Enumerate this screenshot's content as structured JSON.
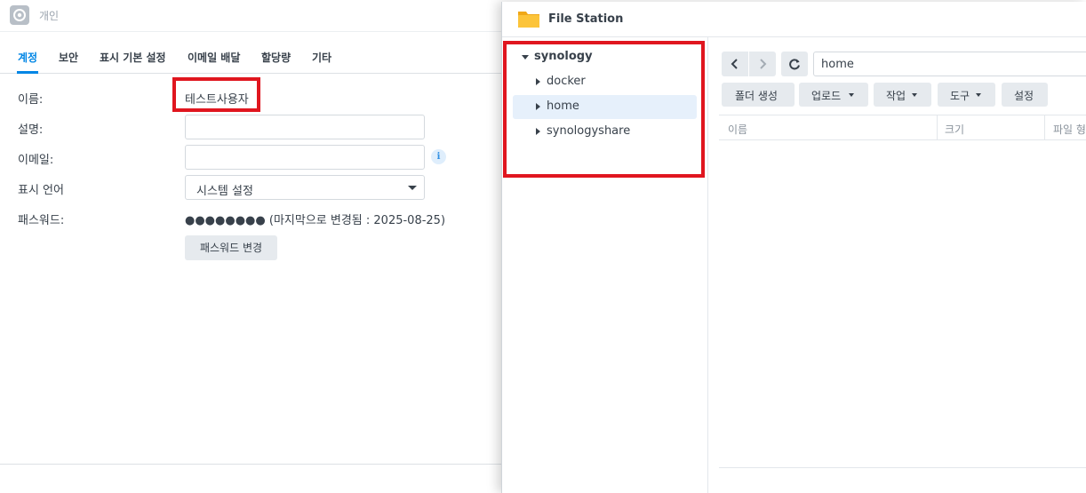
{
  "personal": {
    "title": "개인",
    "tabs": [
      {
        "label": "계정",
        "active": true
      },
      {
        "label": "보안"
      },
      {
        "label": "표시 기본 설정"
      },
      {
        "label": "이메일 배달"
      },
      {
        "label": "할당량"
      },
      {
        "label": "기타"
      }
    ],
    "form": {
      "name_label": "이름:",
      "name_value": "테스트사용자",
      "description_label": "설명:",
      "description_value": "",
      "email_label": "이메일:",
      "email_value": "",
      "info_icon": "i",
      "language_label": "표시 언어",
      "language_value": "시스템 설정",
      "password_label": "패스워드:",
      "password_value": "●●●●●●●● (마지막으로 변경됨 : 2025-08-25)",
      "change_password_button": "패스워드 변경"
    }
  },
  "file_station": {
    "title": "File Station",
    "tree": {
      "root": "synology",
      "children": [
        "docker",
        "home",
        "synologyshare"
      ],
      "selected": "home"
    },
    "path": "home",
    "toolbar": {
      "create_folder": "폴더 생성",
      "upload": "업로드",
      "action": "작업",
      "tools": "도구",
      "settings": "설정"
    },
    "columns": [
      "이름",
      "크기",
      "파일 형"
    ]
  },
  "colors": {
    "accent": "#0086e5",
    "highlight_box": "#e0161f",
    "selected_row": "#e6f0fb",
    "button_bg": "#e6eaee"
  }
}
